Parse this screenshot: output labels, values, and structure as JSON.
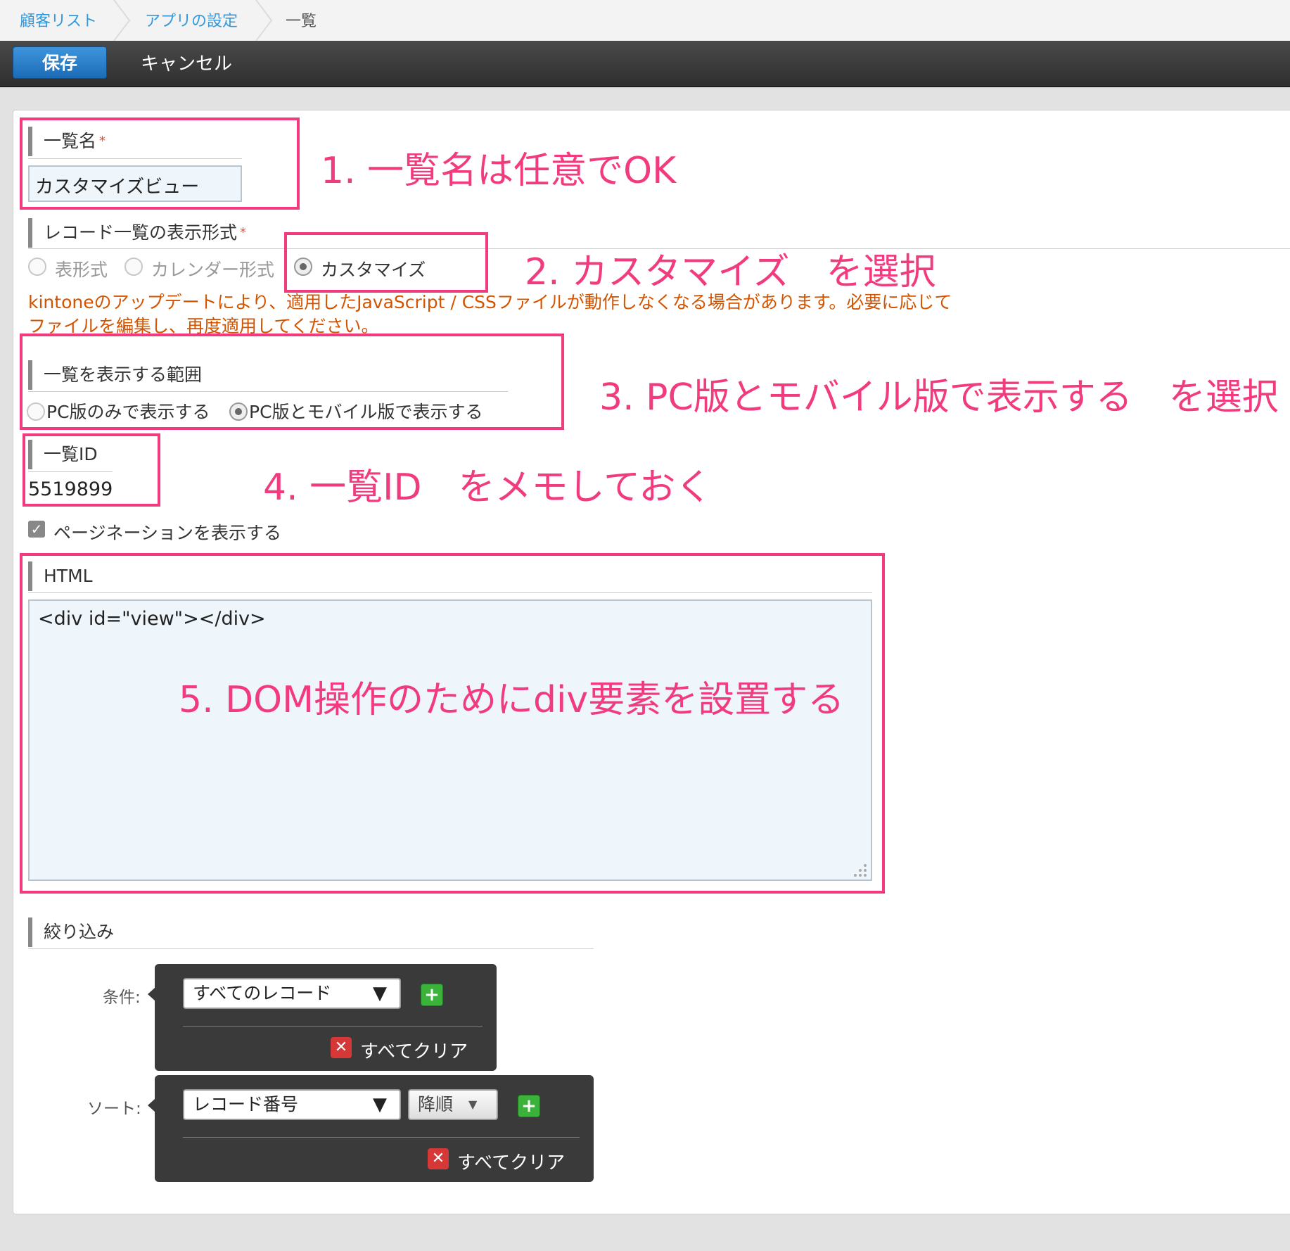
{
  "breadcrumb": [
    "顧客リスト",
    "アプリの設定",
    "一覧"
  ],
  "toolbar": {
    "save_label": "保存",
    "cancel_label": "キャンセル"
  },
  "form": {
    "list_name": {
      "label": "一覧名",
      "required_mark": "*",
      "value": "カスタマイズビュー"
    },
    "display_format": {
      "label": "レコード一覧の表示形式",
      "required_mark": "*",
      "options": [
        "表形式",
        "カレンダー形式",
        "カスタマイズ"
      ],
      "selected": "カスタマイズ"
    },
    "warning_line1": "kintoneのアップデートにより、適用したJavaScript / CSSファイルが動作しなくなる場合があります。必要に応じて",
    "warning_line2": "ファイルを編集し、再度適用してください。",
    "display_scope": {
      "label": "一覧を表示する範囲",
      "options": [
        "PC版のみで表示する",
        "PC版とモバイル版で表示する"
      ],
      "selected": "PC版とモバイル版で表示する"
    },
    "list_id": {
      "label": "一覧ID",
      "value": "5519899"
    },
    "pagination": {
      "label": "ページネーションを表示する",
      "checked": true
    },
    "html": {
      "label": "HTML",
      "value": "<div id=\"view\"></div>"
    },
    "filter": {
      "label": "絞り込み",
      "condition_label": "条件:",
      "condition_value": "すべてのレコード",
      "sort_label": "ソート:",
      "sort_field": "レコード番号",
      "sort_order": "降順",
      "clear_all": "すべてクリア"
    }
  },
  "annotations": [
    "1. 一覧名は任意でOK",
    "2. カスタマイズ　を選択",
    "3. PC版とモバイル版で表示する　を選択",
    "4. 一覧ID　をメモしておく",
    "5. DOM操作のためにdiv要素を設置する"
  ],
  "colors": {
    "annotation": "#f13b7e",
    "link": "#3498db",
    "warning": "#d35400",
    "save_button": "#2a7fc9"
  }
}
